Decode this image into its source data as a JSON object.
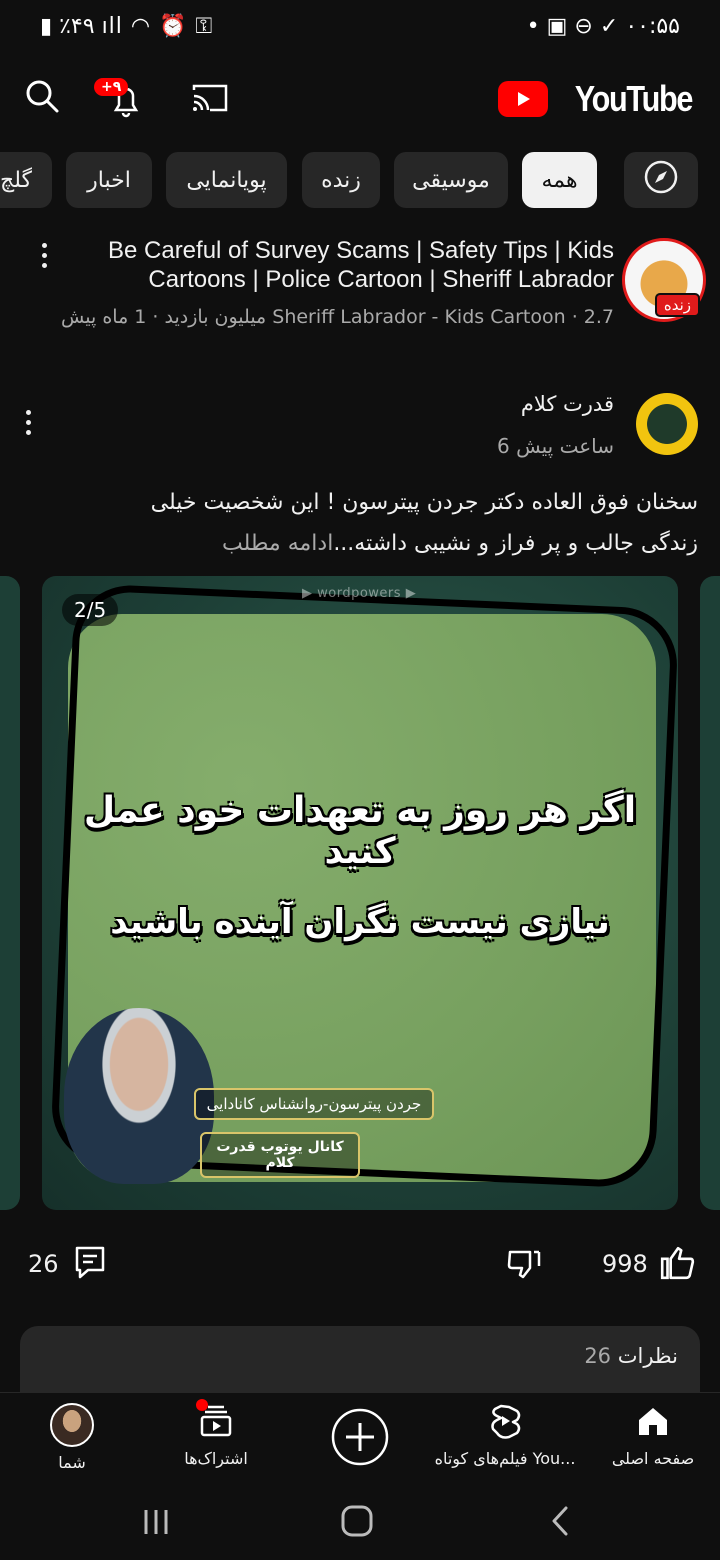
{
  "status_bar": {
    "time": "۰۰:۵۵",
    "battery": "٪۴۹"
  },
  "header": {
    "logo_text": "YouTube",
    "notification_badge": "+۹"
  },
  "chips": [
    {
      "label": "همه",
      "active": true
    },
    {
      "label": "موسیقی",
      "active": false
    },
    {
      "label": "زنده",
      "active": false
    },
    {
      "label": "پویانمایی",
      "active": false
    },
    {
      "label": "اخبار",
      "active": false
    },
    {
      "label": "گلچ",
      "active": false
    }
  ],
  "live_video": {
    "title_line1": "Be Careful of Survey Scams | Safety Tips | Kids",
    "title_line2": "Cartoons | Police Cartoon | Sheriff Labrador",
    "meta": "Sheriff Labrador - Kids Cartoon · 2.7 میلیون بازدید · 1 ماه پیش",
    "live_badge": "زنده"
  },
  "post": {
    "channel": "قدرت کلام",
    "time": "6 ساعت پیش",
    "text_line1": "سخنان فوق العاده دکتر جردن پیترسون ! این شخصیت خیلی",
    "text_line2": "زندگی جالب و پر فراز و نشیبی داشته...",
    "read_more": "ادامه مطلب",
    "image_counter": "2/5",
    "watermark": "wordpowers",
    "quote_line1": "اگر هر روز به تعهدات خود عمل کنید",
    "quote_line2": "نیازی نیست نگران آینده باشید",
    "caption_name": "جردن پیترسون-روانشناس کانادایی",
    "caption_channel": "کانال یوتوب قدرت کلام",
    "likes": "998",
    "comments_count": "26"
  },
  "comments_section": {
    "title": "نظرات",
    "count": "26"
  },
  "bottom_nav": [
    {
      "label": "صفحه اصلی",
      "icon": "home-icon"
    },
    {
      "label": "فیلم‌های کوتاه You...",
      "icon": "shorts-icon"
    },
    {
      "label": "",
      "icon": "create-icon"
    },
    {
      "label": "اشتراک‌ها",
      "icon": "subscriptions-icon"
    },
    {
      "label": "شما",
      "icon": "avatar"
    }
  ],
  "colors": {
    "background": "#0f0f0f",
    "chip": "#272727",
    "accent_red": "#ff0000"
  }
}
